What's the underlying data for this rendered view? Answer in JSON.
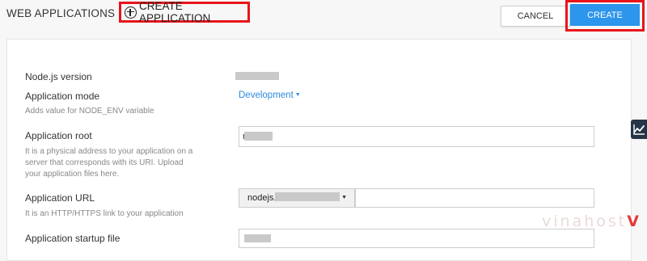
{
  "header": {
    "title": "WEB APPLICATIONS",
    "create_application_label": "CREATE APPLICATION",
    "cancel_label": "CANCEL",
    "create_label": "CREATE"
  },
  "form": {
    "nodejs_version": {
      "label": "Node.js version"
    },
    "application_mode": {
      "label": "Application mode",
      "hint": "Adds value for NODE_ENV variable",
      "selected": "Development"
    },
    "application_root": {
      "label": "Application root",
      "hint": "It is a physical address to your application on a server that corresponds with its URI. Upload your application files here.",
      "value": "r"
    },
    "application_url": {
      "label": "Application URL",
      "hint": "It is an HTTP/HTTPS link to your application",
      "domain_prefix": "nodejs."
    },
    "application_startup_file": {
      "label": "Application startup file"
    }
  },
  "watermark": {
    "text": "vinahost",
    "mark": "V"
  },
  "colors": {
    "accent_blue": "#2c95ec",
    "highlight_red": "#e8141b",
    "link_blue": "#2c8ae0",
    "side_tab_dark": "#263447"
  },
  "icons": {
    "create_application": "plus-circle-icon",
    "side_tab": "chart-trend-icon",
    "dropdown": "caret-down-icon"
  }
}
